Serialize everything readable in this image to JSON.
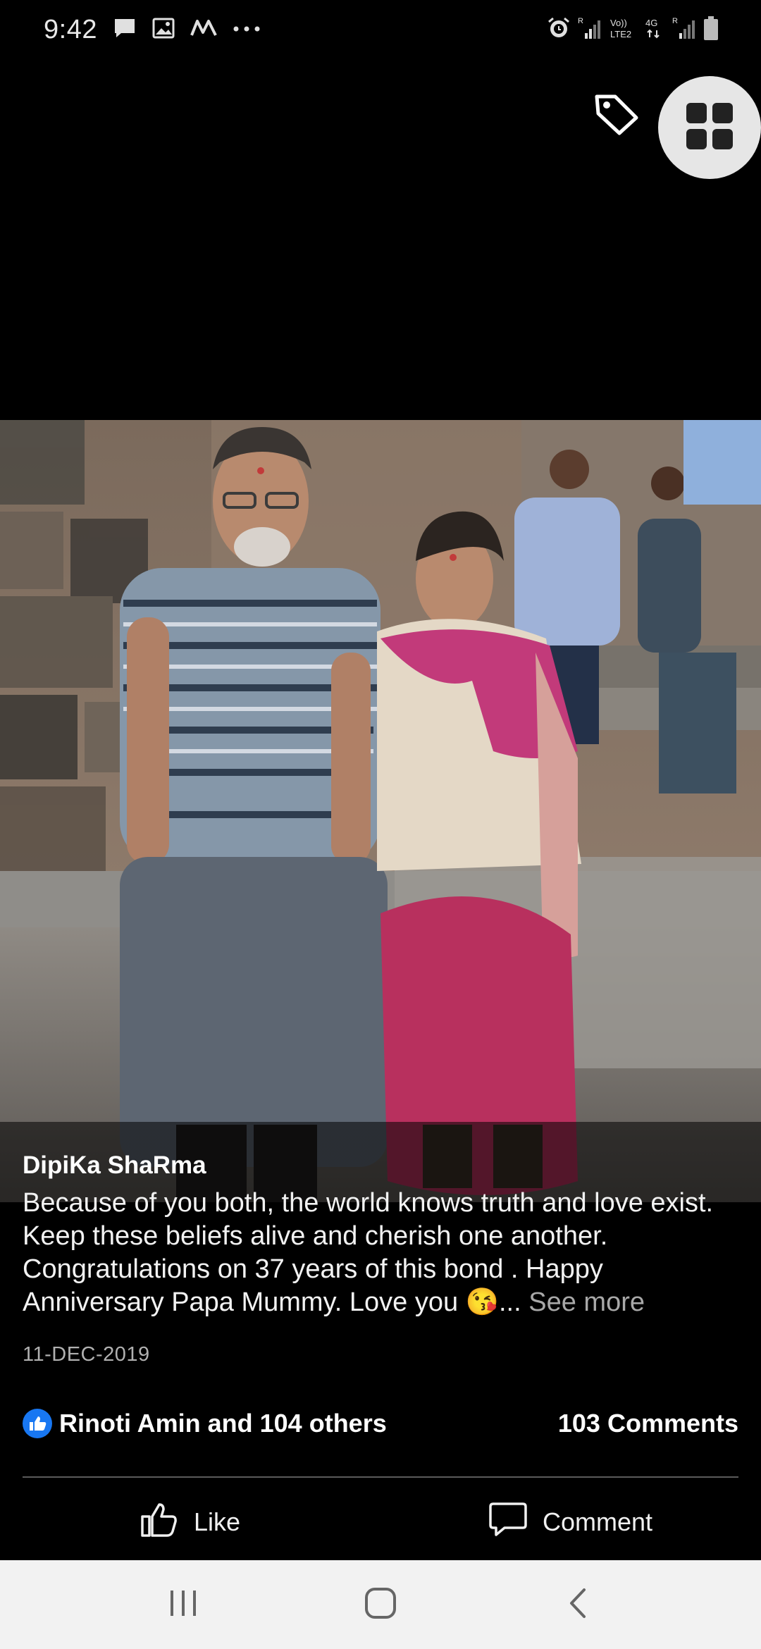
{
  "status_bar": {
    "time": "9:42",
    "left_icons": [
      "message-icon",
      "gallery-icon",
      "myntra-icon",
      "more-icon"
    ],
    "right_icons": [
      "alarm-icon",
      "signal-icon",
      "volte-icon",
      "4g-icon",
      "signal-icon",
      "battery-icon"
    ],
    "volte_label": "Vo))\nLTE2",
    "network_label": "4G"
  },
  "top_actions": {
    "tag_icon": "tag-icon",
    "grid_icon": "grid-icon"
  },
  "post": {
    "author": "DipiKa ShaRma",
    "text": "Because of you both, the world knows truth and love exist. Keep these beliefs alive and cherish one another. Congratulations on 37 years of this bond . Happy Anniversary Papa Mummy. Love you ",
    "emoji": "😘",
    "ellipsis": "...",
    "see_more": "See more",
    "date": "11-DEC-2019"
  },
  "reactions": {
    "summary": "Rinoti Amin and 104 others",
    "comments": "103 Comments"
  },
  "actions": {
    "like": "Like",
    "comment": "Comment"
  },
  "colors": {
    "like_blue": "#1877f2",
    "background": "#000000",
    "nav_bar": "#f2f2f2"
  }
}
